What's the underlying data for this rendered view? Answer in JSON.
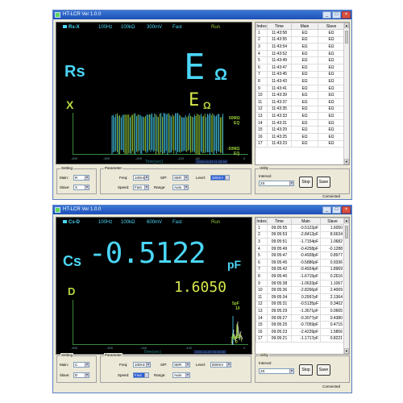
{
  "windows": [
    {
      "title": "HT-LCR Ver 1.0.0",
      "header": {
        "mode": "Rs-X",
        "freq": "100Hz",
        "range": "100kΩ",
        "level": "300mV",
        "speed": "Fast",
        "state": "Run"
      },
      "primary": {
        "name": "Rs",
        "value": "E",
        "unit": "Ω"
      },
      "secondary": {
        "name": "X",
        "value": "E",
        "unit": "Ω"
      },
      "plot": {
        "ytop": "50MΩ",
        "ytop2": "EQ",
        "ybot": "-50MΩ",
        "ybot2": "EQ",
        "xticks": [
          "-400",
          "-300",
          "-200",
          "-120",
          "-60",
          "0"
        ],
        "xlabel": "Time(sec)",
        "timestamp": "2000-04-09 11:43:58"
      },
      "table": {
        "headers": [
          "Index",
          "Time",
          "Main",
          "Slave"
        ],
        "rows": [
          [
            "1",
            "11:43:58",
            "EΩ",
            "EΩ"
          ],
          [
            "2",
            "11:43:55",
            "EΩ",
            "EΩ"
          ],
          [
            "3",
            "11:43:54",
            "EΩ",
            "EΩ"
          ],
          [
            "4",
            "11:43:52",
            "EΩ",
            "EΩ"
          ],
          [
            "5",
            "11:43:49",
            "EΩ",
            "EΩ"
          ],
          [
            "6",
            "11:43:47",
            "EΩ",
            "EΩ"
          ],
          [
            "7",
            "11:43:45",
            "EΩ",
            "EΩ"
          ],
          [
            "8",
            "11:43:43",
            "EΩ",
            "EΩ"
          ],
          [
            "9",
            "11:43:41",
            "EΩ",
            "EΩ"
          ],
          [
            "10",
            "11:43:39",
            "EΩ",
            "EΩ"
          ],
          [
            "11",
            "11:43:37",
            "EΩ",
            "EΩ"
          ],
          [
            "12",
            "11:43:35",
            "EΩ",
            "EΩ"
          ],
          [
            "13",
            "11:43:33",
            "EΩ",
            "EΩ"
          ],
          [
            "14",
            "11:43:31",
            "EΩ",
            "EΩ"
          ],
          [
            "15",
            "11:43:29",
            "EΩ",
            "EΩ"
          ],
          [
            "16",
            "11:43:25",
            "EΩ",
            "EΩ"
          ],
          [
            "17",
            "11:43:23",
            "EΩ",
            "EΩ"
          ]
        ]
      },
      "setting": {
        "caption": "Setting",
        "main_label": "Main:",
        "main_value": "R",
        "slave_label": "Slave:",
        "slave_value": "X"
      },
      "parameter": {
        "caption": "Parameter",
        "freq_label": "Freq:",
        "freq_value": "100Hz",
        "sp_label": "S/P:",
        "sp_value": "SER",
        "level_label": "Level:",
        "level_value": "300mV",
        "speed_label": "Speed:",
        "speed_value": "Fast",
        "range_label": "Range:",
        "range_value": "Auto"
      },
      "utility": {
        "caption": "Utility",
        "interval_label": "Interval:",
        "interval_value": "2S",
        "stop_label": "Stop",
        "save_label": "Save"
      },
      "status": "Connected"
    },
    {
      "title": "HT-LCR Ver 1.0.0",
      "header": {
        "mode": "Cs-D",
        "freq": "100Hz",
        "range": "100kΩ",
        "level": "600mV",
        "speed": "Fast",
        "state": "Run"
      },
      "primary": {
        "name": "Cs",
        "value": "-0.5122",
        "unit": "pF"
      },
      "secondary": {
        "name": "D",
        "value": "1.6050",
        "unit": ""
      },
      "plot": {
        "ytop": "5pF",
        "ytop2": "10",
        "ybot": "-5pF",
        "ybot2": "0",
        "xticks": [
          "-400",
          "-300",
          "-240",
          "-120",
          "0"
        ],
        "xlabel": "Time(sec)",
        "timestamp": "2000-04-09 09:05:55"
      },
      "table": {
        "headers": [
          "Index",
          "Time",
          "Main",
          "Slave"
        ],
        "rows": [
          [
            "1",
            "09:05:55",
            "-0.5122pF",
            "1.6050"
          ],
          [
            "2",
            "09:05:53",
            "-2.8412pF",
            "8.6634"
          ],
          [
            "3",
            "09:05:51",
            "-1.7154pF",
            "1.0682"
          ],
          [
            "4",
            "09:05:49",
            "-0.4258pF",
            "-0.1288"
          ],
          [
            "5",
            "09:05:47",
            "-0.4928pF",
            "0.8977"
          ],
          [
            "6",
            "09:05:45",
            "-0.5886pF",
            "0.9336"
          ],
          [
            "7",
            "09:05:42",
            "-0.4924pF",
            "1.8969"
          ],
          [
            "8",
            "09:05:40",
            "-1.6715pF",
            "0.2616"
          ],
          [
            "9",
            "09:05:38",
            "-1.0633pF",
            "1.1067"
          ],
          [
            "10",
            "09:05:36",
            "-2.8266pF",
            "2.4009"
          ],
          [
            "11",
            "09:05:34",
            "0.2997pF",
            "2.1364"
          ],
          [
            "12",
            "09:05:31",
            "-0.5135pF",
            "0.3402"
          ],
          [
            "13",
            "09:05:29",
            "-1.3671pF",
            "0.0665"
          ],
          [
            "14",
            "09:05:27",
            "-0.3077pF",
            "0.4380"
          ],
          [
            "15",
            "09:05:25",
            "-0.7059pF",
            "0.4715"
          ],
          [
            "16",
            "09:05:23",
            "-2.4239pF",
            "1.5856"
          ],
          [
            "17",
            "09:05:21",
            "-1.1717pF",
            "0.8221"
          ]
        ]
      },
      "setting": {
        "caption": "Setting",
        "main_label": "Main:",
        "main_value": "C",
        "slave_label": "Slave:",
        "slave_value": "D"
      },
      "parameter": {
        "caption": "Parameter",
        "freq_label": "Freq:",
        "freq_value": "100Hz",
        "sp_label": "S/P:",
        "sp_value": "SER",
        "level_label": "Level:",
        "level_value": "600mV",
        "speed_label": "Speed:",
        "speed_value": "Fast",
        "range_label": "Range:",
        "range_value": "Auto"
      },
      "utility": {
        "caption": "Utility",
        "interval_label": "Interval:",
        "interval_value": "2S",
        "stop_label": "Stop",
        "save_label": "Save"
      },
      "status": "Connected"
    }
  ]
}
